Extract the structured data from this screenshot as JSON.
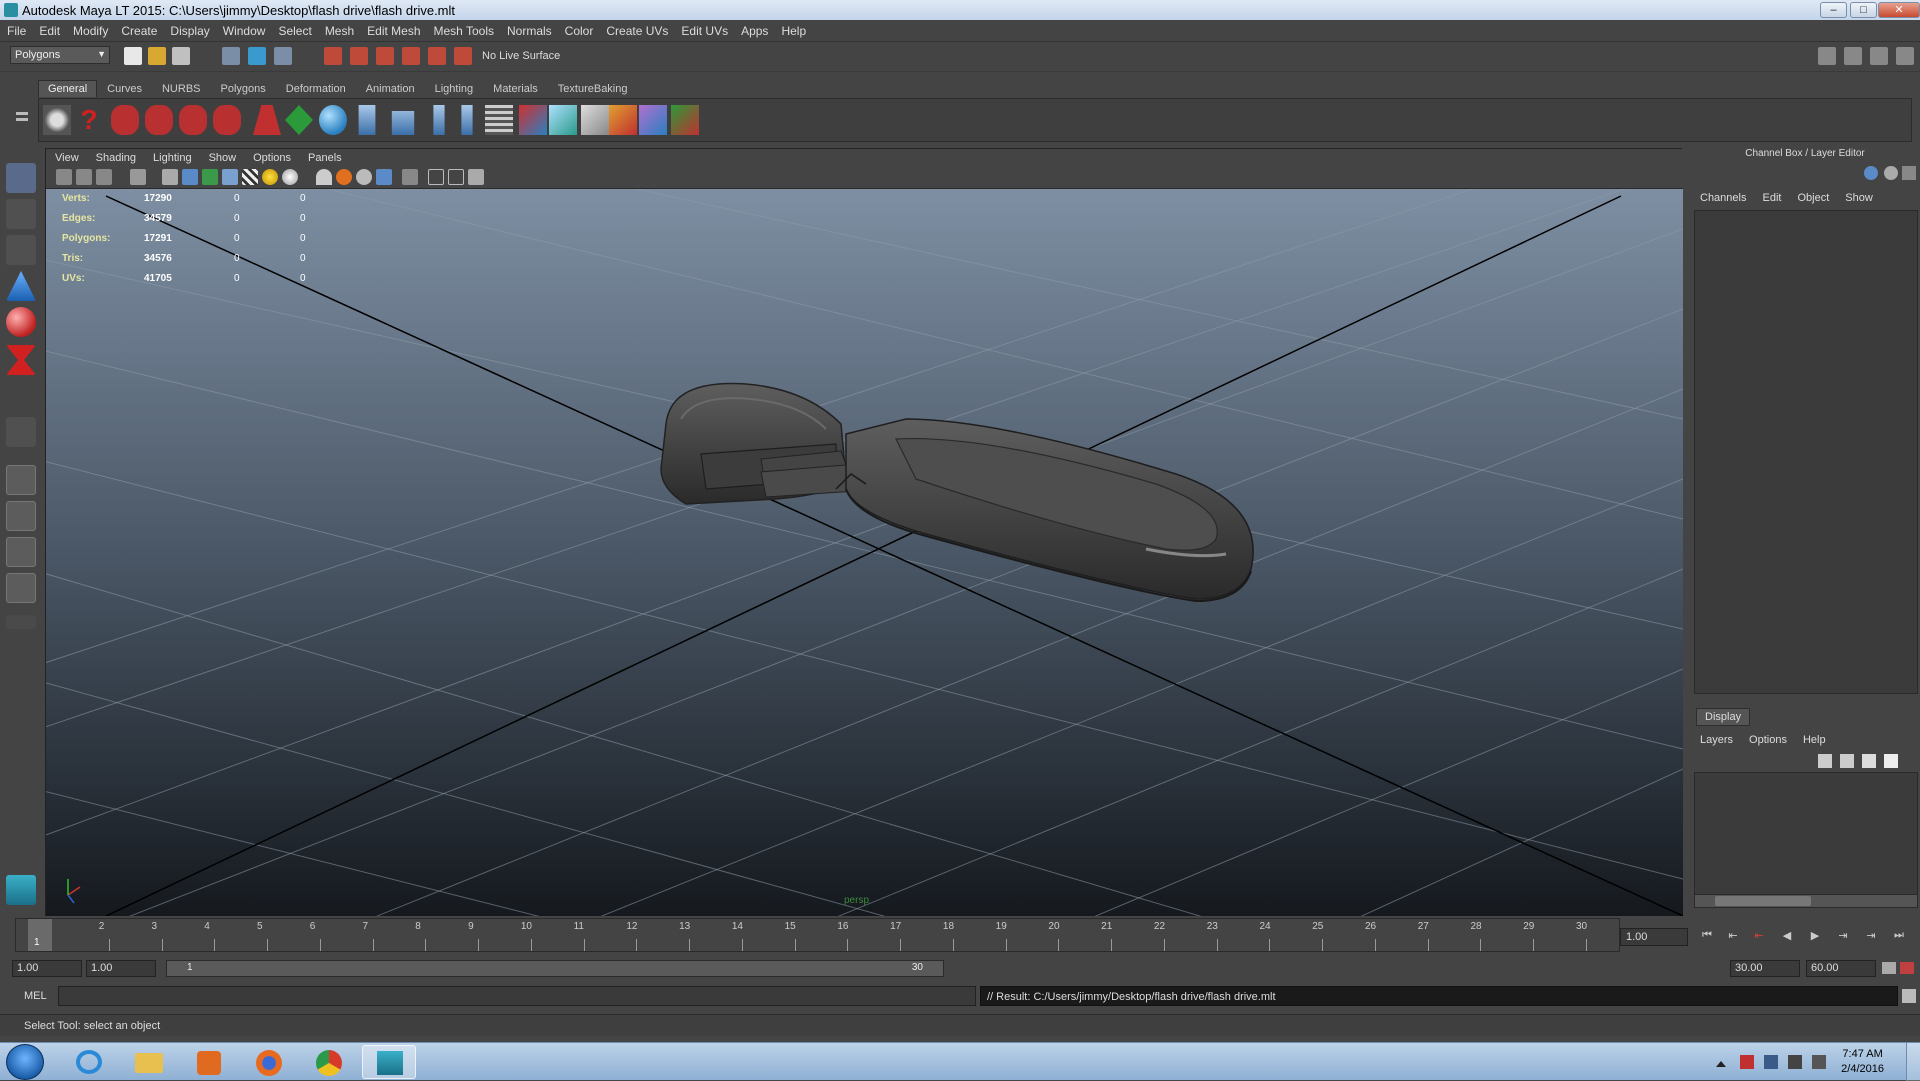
{
  "window": {
    "title": "Autodesk Maya LT 2015: C:\\Users\\jimmy\\Desktop\\flash drive\\flash drive.mlt",
    "controls": [
      "minimize",
      "maximize",
      "close"
    ]
  },
  "menubar": [
    "File",
    "Edit",
    "Modify",
    "Create",
    "Display",
    "Window",
    "Select",
    "Mesh",
    "Edit Mesh",
    "Mesh Tools",
    "Normals",
    "Color",
    "Create UVs",
    "Edit UVs",
    "Apps",
    "Help"
  ],
  "statusline": {
    "menu_set": "Polygons",
    "live_surface": "No Live Surface"
  },
  "shelf": {
    "tabs": [
      "General",
      "Curves",
      "NURBS",
      "Polygons",
      "Deformation",
      "Animation",
      "Lighting",
      "Materials",
      "TextureBaking"
    ],
    "active_tab": "General"
  },
  "viewport": {
    "menu": [
      "View",
      "Shading",
      "Lighting",
      "Show",
      "Options",
      "Panels"
    ],
    "camera": "persp",
    "hud": [
      {
        "label": "Verts:",
        "v1": "17290",
        "v2": "0",
        "v3": "0"
      },
      {
        "label": "Edges:",
        "v1": "34579",
        "v2": "0",
        "v3": "0"
      },
      {
        "label": "Polygons:",
        "v1": "17291",
        "v2": "0",
        "v3": "0"
      },
      {
        "label": "Tris:",
        "v1": "34576",
        "v2": "0",
        "v3": "0"
      },
      {
        "label": "UVs:",
        "v1": "41705",
        "v2": "0",
        "v3": "0"
      }
    ]
  },
  "channel_box": {
    "title": "Channel Box / Layer Editor",
    "menu": [
      "Channels",
      "Edit",
      "Object",
      "Show"
    ]
  },
  "layer_editor": {
    "tab": "Display",
    "menu": [
      "Layers",
      "Options",
      "Help"
    ]
  },
  "timeline": {
    "ticks": [
      "1",
      "2",
      "3",
      "4",
      "5",
      "6",
      "7",
      "8",
      "9",
      "10",
      "11",
      "12",
      "13",
      "14",
      "15",
      "16",
      "17",
      "18",
      "19",
      "20",
      "21",
      "22",
      "23",
      "24",
      "25",
      "26",
      "27",
      "28",
      "29",
      "30"
    ],
    "current_frame": "1",
    "current_time": "1.00"
  },
  "range": {
    "start": "1.00",
    "playback_start": "1.00",
    "slider_start": "1",
    "slider_end": "30",
    "playback_end": "30.00",
    "end": "60.00"
  },
  "command_line": {
    "label": "MEL",
    "result": "// Result: C:/Users/jimmy/Desktop/flash drive/flash drive.mlt"
  },
  "help_line": "Select Tool: select an object",
  "taskbar": {
    "time": "7:47 AM",
    "date": "2/4/2016"
  }
}
